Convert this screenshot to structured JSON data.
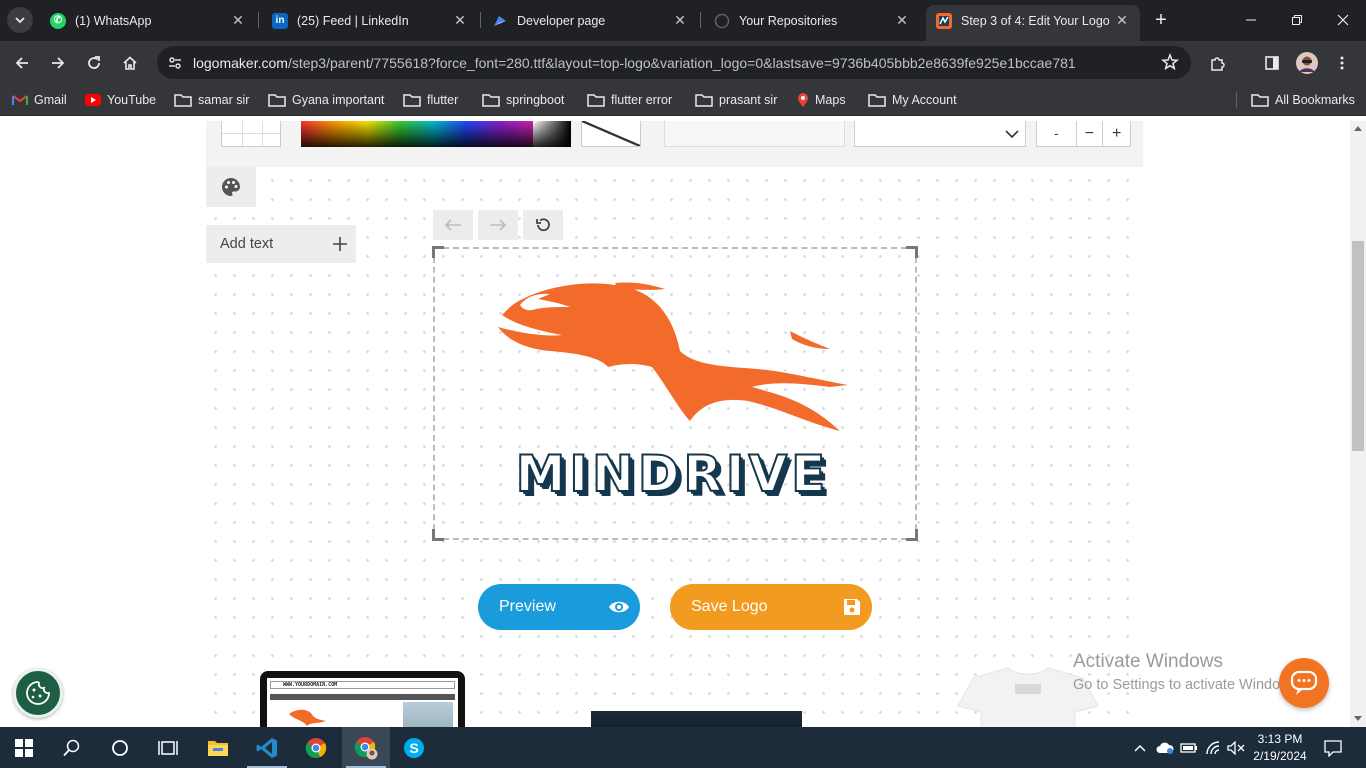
{
  "browser": {
    "tabs": [
      {
        "title": "(1) WhatsApp",
        "icon": "whatsapp-icon",
        "active": false
      },
      {
        "title": "(25) Feed | LinkedIn",
        "icon": "linkedin-icon",
        "active": false
      },
      {
        "title": "Developer page",
        "icon": "developer-icon",
        "active": false
      },
      {
        "title": "Your Repositories",
        "icon": "github-icon",
        "active": false
      },
      {
        "title": "Step 3 of 4: Edit Your Logo |",
        "icon": "logomaker-icon",
        "active": true
      }
    ],
    "url_host": "logomaker.com",
    "url_path": "/step3/parent/7755618?force_font=280.ttf&layout=top-logo&variation_logo=0&lastsave=9736b405bbb2e8639fe925e1bccae781",
    "bookmarks": [
      {
        "label": "Gmail",
        "icon": "gmail-icon"
      },
      {
        "label": "YouTube",
        "icon": "youtube-icon"
      },
      {
        "label": "samar sir",
        "icon": "folder-icon"
      },
      {
        "label": "Gyana important",
        "icon": "folder-icon"
      },
      {
        "label": "flutter",
        "icon": "folder-icon"
      },
      {
        "label": "springboot",
        "icon": "folder-icon"
      },
      {
        "label": "flutter error",
        "icon": "folder-icon"
      },
      {
        "label": "prasant sir",
        "icon": "folder-icon"
      },
      {
        "label": "Maps",
        "icon": "maps-icon"
      },
      {
        "label": "My Account",
        "icon": "folder-icon"
      }
    ],
    "all_bookmarks": "All Bookmarks"
  },
  "editor": {
    "size_value": "-",
    "add_text_label": "Add text",
    "brand_text": "MINDRIVE",
    "preview_label": "Preview",
    "save_label": "Save Logo",
    "mock_url": "WWW.YOURDOMAIN.COM"
  },
  "colors": {
    "logo_orange": "#f26b2a",
    "logo_navy": "#14374e",
    "preview_blue": "#1a9cdc",
    "save_orange": "#f39a20"
  },
  "overlay": {
    "activate_title": "Activate Windows",
    "activate_sub": "Go to Settings to activate Windows."
  },
  "taskbar": {
    "time": "3:13 PM",
    "date": "2/19/2024"
  }
}
